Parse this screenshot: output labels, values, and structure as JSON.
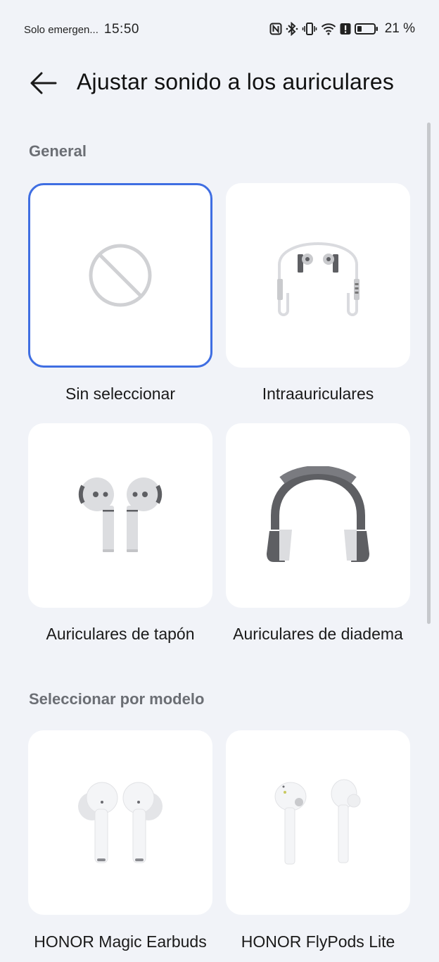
{
  "status_bar": {
    "carrier": "Solo emergen...",
    "time": "15:50",
    "battery": "21 %",
    "icons": [
      "nfc-icon",
      "bluetooth-icon",
      "vibrate-icon",
      "wifi-icon",
      "alert-icon",
      "battery-icon"
    ]
  },
  "app_bar": {
    "back_icon": "arrow-left-icon",
    "title": "Ajustar sonido a los auriculares"
  },
  "sections": {
    "general": {
      "title": "General",
      "items": [
        {
          "label": "Sin seleccionar",
          "icon": "no-selection-icon",
          "selected": true
        },
        {
          "label": "Intraauriculares",
          "icon": "in-ear-wired-icon",
          "selected": false
        },
        {
          "label": "Auriculares de tapón",
          "icon": "earbuds-icon",
          "selected": false
        },
        {
          "label": "Auriculares de diadema",
          "icon": "headband-headphones-icon",
          "selected": false
        }
      ]
    },
    "by_model": {
      "title": "Seleccionar por modelo",
      "items": [
        {
          "label": "HONOR Magic Earbuds",
          "icon": "honor-magic-earbuds-icon"
        },
        {
          "label": "HONOR FlyPods Lite",
          "icon": "honor-flypods-lite-icon"
        }
      ]
    }
  },
  "colors": {
    "background": "#f1f3f8",
    "tile": "#ffffff",
    "selected_border": "#3f6ee2",
    "section_title": "#6b6e74"
  }
}
